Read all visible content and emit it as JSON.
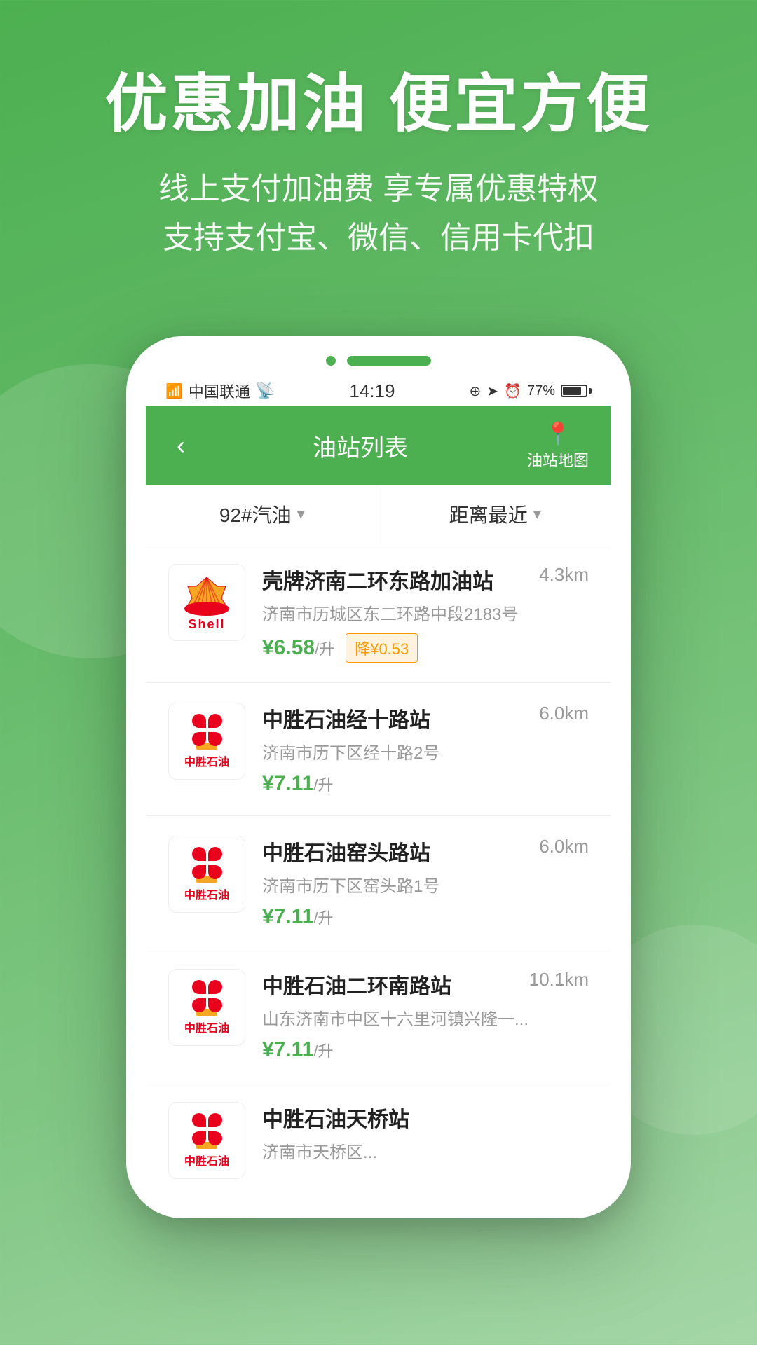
{
  "hero": {
    "title": "优惠加油 便宜方便",
    "subtitle_line1": "线上支付加油费 享专属优惠特权",
    "subtitle_line2": "支持支付宝、微信、信用卡代扣"
  },
  "status_bar": {
    "carrier": "中国联通",
    "time": "14:19",
    "battery": "77%"
  },
  "nav": {
    "title": "油站列表",
    "map_label": "油站地图",
    "back_label": "‹"
  },
  "filter": {
    "fuel_type": "92#汽油",
    "sort": "距离最近"
  },
  "stations": [
    {
      "name": "壳牌济南二环东路加油站",
      "address": "济南市历城区东二环路中段2183号",
      "distance": "4.3km",
      "price": "¥6.58",
      "unit": "/升",
      "badge": "降¥0.53",
      "logo_type": "shell"
    },
    {
      "name": "中胜石油经十路站",
      "address": "济南市历下区经十路2号",
      "distance": "6.0km",
      "price": "¥7.11",
      "unit": "/升",
      "badge": "",
      "logo_type": "zhongsheng"
    },
    {
      "name": "中胜石油窑头路站",
      "address": "济南市历下区窑头路1号",
      "distance": "6.0km",
      "price": "¥7.11",
      "unit": "/升",
      "badge": "",
      "logo_type": "zhongsheng"
    },
    {
      "name": "中胜石油二环南路站",
      "address": "山东济南市中区十六里河镇兴隆一...",
      "distance": "10.1km",
      "price": "¥7.11",
      "unit": "/升",
      "badge": "",
      "logo_type": "zhongsheng"
    },
    {
      "name": "中胜石油天桥站",
      "address": "济南市天桥区...",
      "distance": "",
      "price": "",
      "unit": "",
      "badge": "",
      "logo_type": "zhongsheng"
    }
  ]
}
